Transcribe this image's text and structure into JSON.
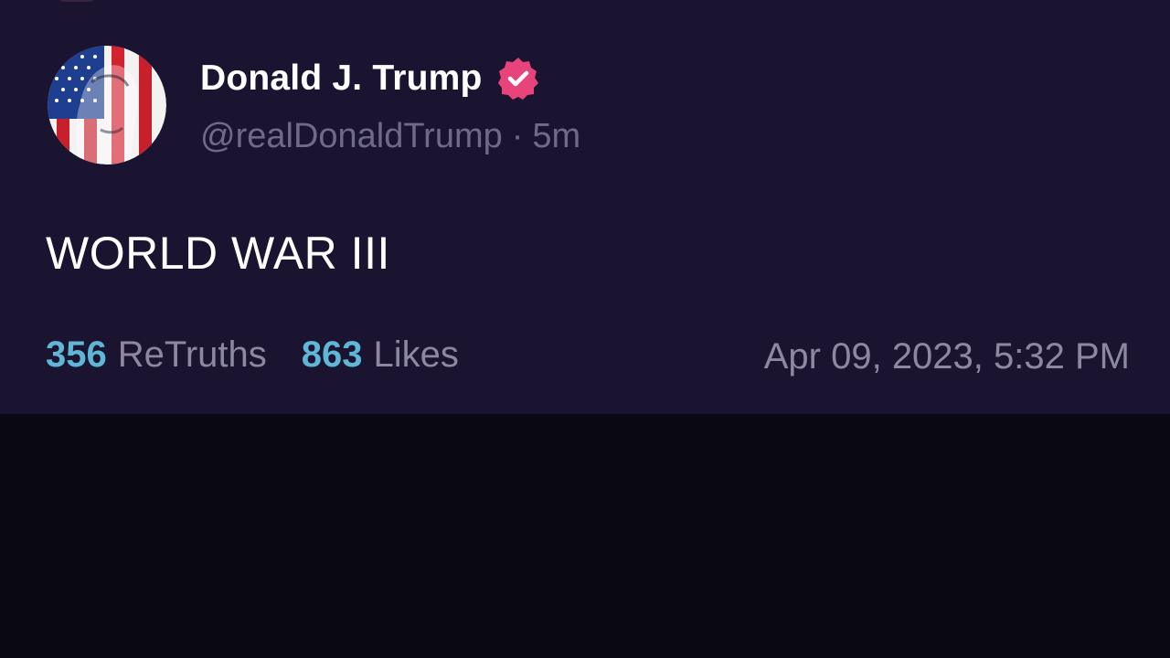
{
  "post": {
    "display_name": "Donald J. Trump",
    "verified": true,
    "verified_icon": "verified-badge-icon",
    "handle": "@realDonaldTrump",
    "separator": "·",
    "relative_time": "5m",
    "text": "WORLD WAR III",
    "retruths_count": "356",
    "retruths_label": "ReTruths",
    "likes_count": "863",
    "likes_label": "Likes",
    "timestamp": "Apr 09, 2023, 5:32 PM"
  },
  "colors": {
    "card_background": "#1b1430",
    "page_background": "#0a0812",
    "verified_badge": "#e8437a",
    "stat_count": "#5fb6d6",
    "muted_text": "#8c88a0"
  }
}
